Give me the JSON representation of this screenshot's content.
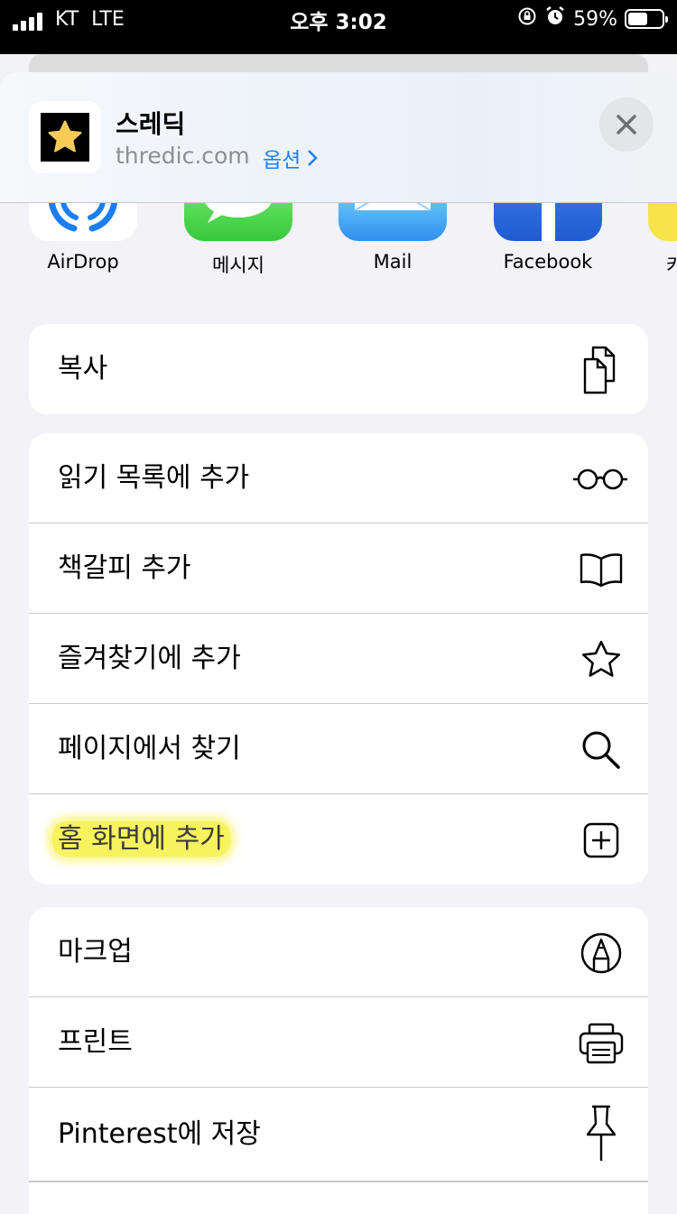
{
  "status_bar": {
    "carrier": "KT",
    "network": "LTE",
    "time": "오후 3:02",
    "battery_percent": "59%",
    "battery_level": 0.59
  },
  "header": {
    "site_title": "스레딕",
    "site_url": "thredic.com",
    "options_label": "옵션",
    "site_icon": "star-icon",
    "close_icon": "close-icon"
  },
  "share_apps": [
    {
      "label": "AirDrop",
      "icon": "airdrop-icon"
    },
    {
      "label": "메시지",
      "icon": "messages-icon"
    },
    {
      "label": "Mail",
      "icon": "mail-icon"
    },
    {
      "label": "Facebook",
      "icon": "facebook-icon"
    },
    {
      "label": "카",
      "icon": "kakaotalk-icon"
    }
  ],
  "actions_group1": [
    {
      "label": "복사",
      "icon": "copy-icon"
    }
  ],
  "actions_group2": [
    {
      "label": "읽기 목록에 추가",
      "icon": "glasses-icon"
    },
    {
      "label": "책갈피 추가",
      "icon": "book-icon"
    },
    {
      "label": "즐겨찾기에 추가",
      "icon": "star-outline-icon"
    },
    {
      "label": "페이지에서 찾기",
      "icon": "search-icon"
    },
    {
      "label": "홈 화면에 추가",
      "icon": "plus-square-icon"
    }
  ],
  "actions_group3": [
    {
      "label": "마크업",
      "icon": "markup-icon"
    },
    {
      "label": "프린트",
      "icon": "printer-icon"
    },
    {
      "label": "Pinterest에 저장",
      "icon": "pin-icon"
    }
  ],
  "colors": {
    "accent": "#1a82f7",
    "highlight": "#f7f35f",
    "background": "#f2f2f7"
  }
}
